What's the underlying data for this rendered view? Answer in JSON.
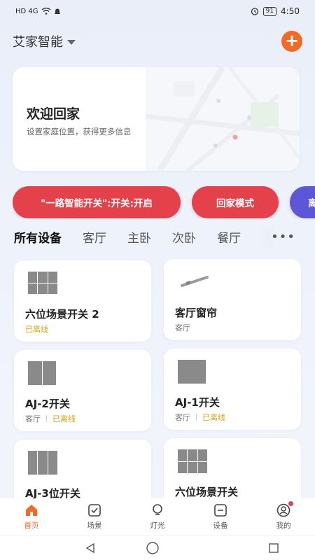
{
  "status_bar": {
    "signal": "HD 4G",
    "battery": "91",
    "time": "4:50"
  },
  "header": {
    "home_name": "艾家智能"
  },
  "welcome": {
    "title": "欢迎回家",
    "subtitle": "设置家庭位置，获得更多信息"
  },
  "quick_scenes": [
    {
      "label": "\"一路智能开关\":开关:开启"
    },
    {
      "label": "回家模式"
    },
    {
      "label": "离"
    }
  ],
  "tabs": [
    {
      "label": "所有设备",
      "active": true
    },
    {
      "label": "客厅"
    },
    {
      "label": "主卧"
    },
    {
      "label": "次卧"
    },
    {
      "label": "餐厅"
    }
  ],
  "more_label": "•••",
  "devices": [
    {
      "name": "六位场景开关 2",
      "room": "",
      "status": "已离线",
      "thumb": "six-gang-switch"
    },
    {
      "name": "客厅窗帘",
      "room": "客厅",
      "status": "",
      "thumb": "curtain-rail"
    },
    {
      "name": "AJ-2开关",
      "room": "客厅",
      "status": "已离线",
      "thumb": "two-gang-switch"
    },
    {
      "name": "AJ-1开关",
      "room": "客厅",
      "status": "已离线",
      "thumb": "one-gang-switch"
    },
    {
      "name": "AJ-3位开关",
      "room": "",
      "status": "",
      "thumb": "three-gang-switch"
    },
    {
      "name": "六位场景开关",
      "room": "",
      "status": "",
      "thumb": "six-gang-switch"
    }
  ],
  "bottom_nav": [
    {
      "label": "首页",
      "icon": "home-icon",
      "active": true
    },
    {
      "label": "场景",
      "icon": "scene-icon"
    },
    {
      "label": "灯光",
      "icon": "bulb-icon"
    },
    {
      "label": "设备",
      "icon": "device-icon"
    },
    {
      "label": "我的",
      "icon": "profile-icon"
    }
  ],
  "colors": {
    "accent": "#f26a26",
    "scene_pill": "#e4414a",
    "scene_pill_alt": "#5b57d6",
    "offline": "#d7a21a"
  }
}
